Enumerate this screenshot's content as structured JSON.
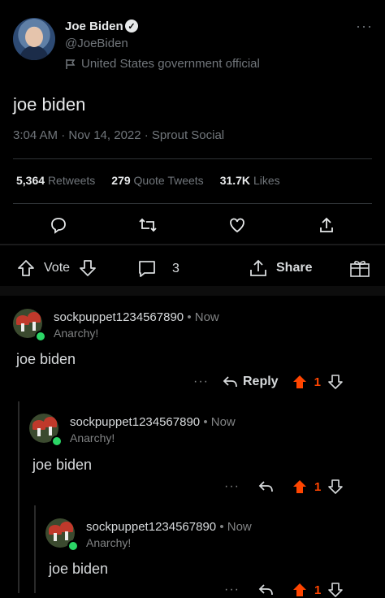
{
  "tweet": {
    "name": "Joe Biden",
    "handle": "@JoeBiden",
    "label": "United States government official",
    "text": "joe biden",
    "meta": "3:04 AM · Nov 14, 2022 · Sprout Social",
    "stats": [
      {
        "value": "5,364",
        "label": "Retweets"
      },
      {
        "value": "279",
        "label": "Quote Tweets"
      },
      {
        "value": "31.7K",
        "label": "Likes"
      }
    ]
  },
  "reddit_bar": {
    "vote_label": "Vote",
    "comment_count": "3",
    "share_label": "Share"
  },
  "comments": [
    {
      "user": "sockpuppet1234567890",
      "time": "• Now",
      "flair": "Anarchy!",
      "body": "joe biden",
      "reply_label": "Reply",
      "score": "1"
    },
    {
      "user": "sockpuppet1234567890",
      "time": "• Now",
      "flair": "Anarchy!",
      "body": "joe biden",
      "score": "1"
    },
    {
      "user": "sockpuppet1234567890",
      "time": "• Now",
      "flair": "Anarchy!",
      "body": "joe biden",
      "score": "1"
    }
  ],
  "colors": {
    "upvote": "#ff4500",
    "background": "#000000"
  }
}
